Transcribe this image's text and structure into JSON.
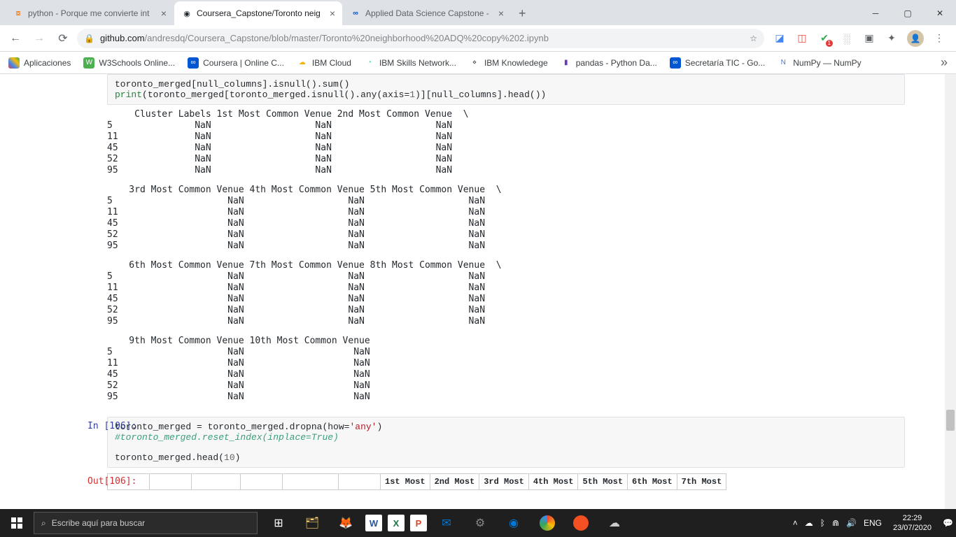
{
  "tabs": [
    {
      "title": "python - Porque me convierte int",
      "active": false
    },
    {
      "title": "Coursera_Capstone/Toronto neig",
      "active": true
    },
    {
      "title": "Applied Data Science Capstone - ",
      "active": false
    }
  ],
  "url": {
    "host": "github.com",
    "path": "/andresdq/Coursera_Capstone/blob/master/Toronto%20neighborhood%20ADQ%20copy%202.ipynb"
  },
  "bookmarks": {
    "apps": "Aplicaciones",
    "items": [
      {
        "label": "W3Schools Online...",
        "color": "#4caf50"
      },
      {
        "label": "Coursera | Online C...",
        "color": "#0056d2"
      },
      {
        "label": "IBM Cloud",
        "color": "#f4b400"
      },
      {
        "label": "IBM Skills Network...",
        "color": "#3ddc84"
      },
      {
        "label": "IBM Knowledege",
        "color": "#333"
      },
      {
        "label": "pandas - Python Da...",
        "color": "#673ab7"
      },
      {
        "label": "Secretaría TIC - Go...",
        "color": "#0056d2"
      },
      {
        "label": "NumPy — NumPy",
        "color": "#4d77cf"
      }
    ]
  },
  "cell_top": {
    "line1": "toronto_merged[null_columns].isnull().sum()",
    "line2_pre": "print",
    "line2_mid": "(toronto_merged[toronto_merged.isnull().any(axis=",
    "line2_num": "1",
    "line2_post": ")][null_columns].head())"
  },
  "output_blocks": [
    "     Cluster Labels 1st Most Common Venue 2nd Most Common Venue  \\\n5               NaN                   NaN                   NaN\n11              NaN                   NaN                   NaN\n45              NaN                   NaN                   NaN\n52              NaN                   NaN                   NaN\n95              NaN                   NaN                   NaN",
    "    3rd Most Common Venue 4th Most Common Venue 5th Most Common Venue  \\\n5                     NaN                   NaN                   NaN\n11                    NaN                   NaN                   NaN\n45                    NaN                   NaN                   NaN\n52                    NaN                   NaN                   NaN\n95                    NaN                   NaN                   NaN",
    "    6th Most Common Venue 7th Most Common Venue 8th Most Common Venue  \\\n5                     NaN                   NaN                   NaN\n11                    NaN                   NaN                   NaN\n45                    NaN                   NaN                   NaN\n52                    NaN                   NaN                   NaN\n95                    NaN                   NaN                   NaN",
    "    9th Most Common Venue 10th Most Common Venue\n5                     NaN                    NaN\n11                    NaN                    NaN\n45                    NaN                    NaN\n52                    NaN                    NaN\n95                    NaN                    NaN"
  ],
  "cell106": {
    "prompt_in": "In [106]:",
    "prompt_out": "Out[106]:",
    "line1_pre": "toronto_merged = toronto_merged.dropna(how=",
    "line1_str": "'any'",
    "line1_post": ")",
    "line2": "#toronto_merged.reset_index(inplace=True)",
    "line3": "toronto_merged.head(",
    "line3_num": "10",
    "line3_post": ")"
  },
  "table_headers": [
    "",
    "1st Most",
    "2nd Most",
    "3rd Most",
    "4th Most",
    "5th Most",
    "6th Most",
    "7th Most"
  ],
  "taskbar": {
    "search": "Escribe aquí para buscar",
    "lang": "ENG",
    "time": "22:29",
    "date": "23/07/2020"
  }
}
